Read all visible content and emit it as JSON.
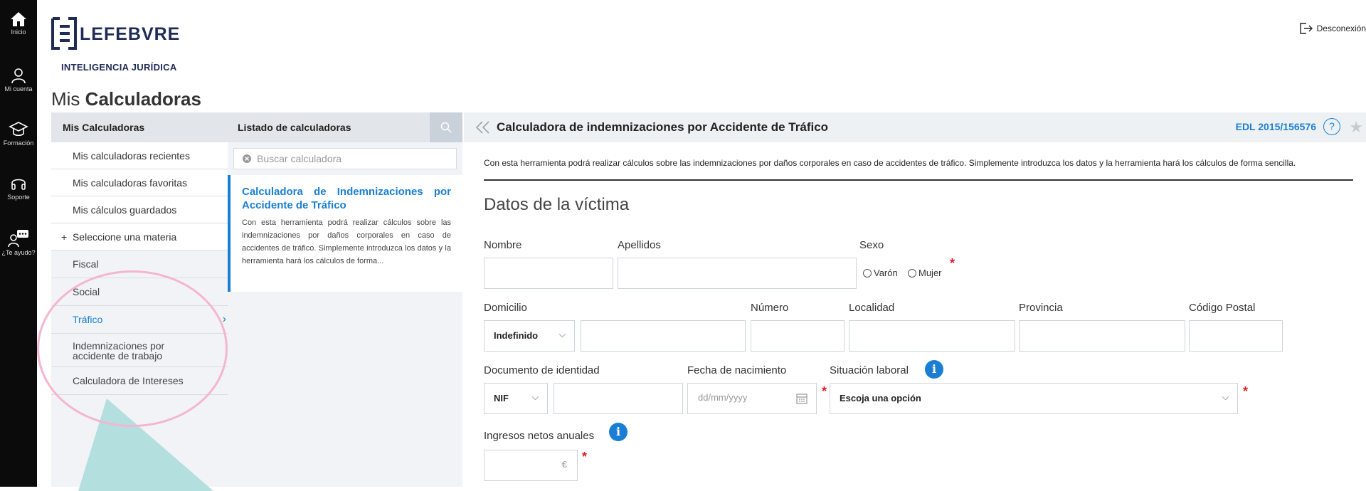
{
  "sidebar": {
    "items": [
      {
        "label": "Inicio",
        "icon": "home-icon"
      },
      {
        "label": "Mi cuenta",
        "icon": "user-icon"
      },
      {
        "label": "Formación",
        "icon": "graduation-cap-icon"
      },
      {
        "label": "Soporte",
        "icon": "headset-icon"
      },
      {
        "label": "¿Te ayudo?",
        "icon": "chat-assistant-icon"
      }
    ]
  },
  "header": {
    "logo_text": "LEFEBVRE",
    "logo_sub": "INTELIGENCIA JURÍDICA",
    "disconnect": "Desconexión"
  },
  "page": {
    "title_light": "Mis ",
    "title_bold": "Calculadoras"
  },
  "col1": {
    "head": "Mis Calculadoras",
    "items": [
      "Mis calculadoras recientes",
      "Mis calculadoras favoritas",
      "Mis cálculos guardados"
    ],
    "subject": "Seleccione una materia",
    "subject_icon": "+",
    "materias": [
      "Fiscal",
      "Social",
      "Tráfico",
      "Indemnizaciones por accidente de trabajo",
      "Calculadora de Intereses"
    ]
  },
  "col2": {
    "head": "Listado de calculadoras",
    "search_placeholder": "Buscar calculadora",
    "card_title": "Calculadora de Indemnizaciones por Accidente de Tráfico",
    "card_desc": "Con esta herramienta podrá realizar cálculos sobre las indemnizaciones por daños corporales en caso de accidentes de tráfico. Simplemente introduzca los datos y la herramienta hará los cálculos de forma..."
  },
  "main": {
    "title": "Calculadora de indemnizaciones por Accidente de Tráfico",
    "ref": "EDL 2015/156576",
    "help": "?",
    "intro": "Con esta herramienta podrá realizar cálculos sobre las indemnizaciones por daños corporales en caso de accidentes de tráfico. Simplemente introduzca los datos y la herramienta hará los cálculos de forma sencilla.",
    "section": "Datos de la víctima",
    "labels": {
      "nombre": "Nombre",
      "apellidos": "Apellidos",
      "sexo": "Sexo",
      "domicilio": "Domicilio",
      "numero": "Número",
      "localidad": "Localidad",
      "provincia": "Provincia",
      "cp": "Código Postal",
      "documento": "Documento de identidad",
      "fecha": "Fecha de nacimiento",
      "situacion": "Situación laboral",
      "ingresos": "Ingresos netos anuales"
    },
    "sexo_options": [
      "Varón",
      "Mujer"
    ],
    "domicilio_value": "Indefinido",
    "documento_value": "NIF",
    "fecha_placeholder": "dd/mm/yyyy",
    "situacion_value": "Escoja una opción",
    "currency": "€",
    "required_mark": "*",
    "info_mark": "i"
  },
  "colors": {
    "accent": "#1a7fd4",
    "required": "#e01b24",
    "brand": "#1f2a55"
  }
}
